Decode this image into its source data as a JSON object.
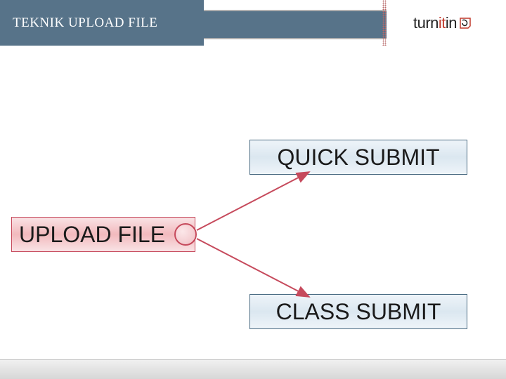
{
  "header": {
    "title": "TEKNIK UPLOAD FILE",
    "brand_black": "turn",
    "brand_red": "it",
    "brand_black2": "in"
  },
  "diagram": {
    "source_label": "UPLOAD FILE",
    "target1_label": "QUICK SUBMIT",
    "target2_label": "CLASS SUBMIT"
  },
  "colors": {
    "header_bg": "#577389",
    "accent_red": "#c64a5c",
    "node_border_blue": "#4a6b82"
  }
}
